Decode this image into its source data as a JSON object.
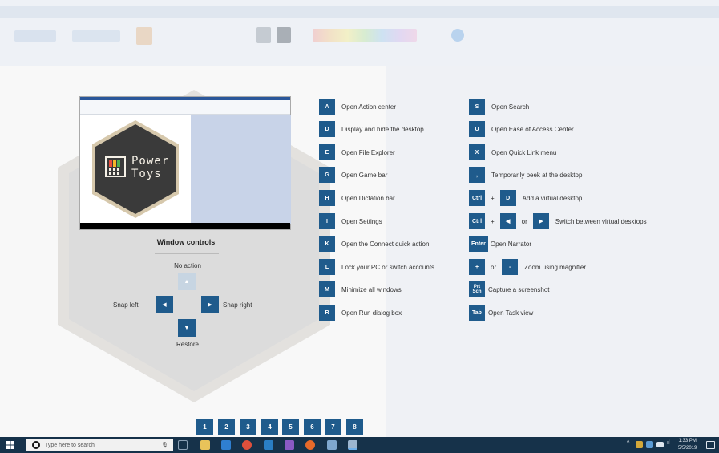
{
  "window_controls": {
    "title": "Window controls",
    "up_label": "No action",
    "left_label": "Snap left",
    "right_label": "Snap right",
    "down_label": "Restore"
  },
  "logo_text": [
    "Power",
    "Toys"
  ],
  "shortcuts_left": [
    {
      "key": "A",
      "label": "Open Action center"
    },
    {
      "key": "D",
      "label": "Display and hide the desktop"
    },
    {
      "key": "E",
      "label": "Open File Explorer"
    },
    {
      "key": "G",
      "label": "Open Game bar"
    },
    {
      "key": "H",
      "label": "Open Dictation bar"
    },
    {
      "key": "I",
      "label": "Open Settings"
    },
    {
      "key": "K",
      "label": "Open the Connect quick action"
    },
    {
      "key": "L",
      "label": "Lock your PC or switch accounts"
    },
    {
      "key": "M",
      "label": "Minimize all windows"
    },
    {
      "key": "R",
      "label": "Open Run dialog box"
    }
  ],
  "shortcuts_right": [
    {
      "key": "S",
      "label": "Open Search"
    },
    {
      "key": "U",
      "label": "Open Ease of Access Center"
    },
    {
      "key": "X",
      "label": "Open Quick Link menu"
    },
    {
      "key": ",",
      "label": "Temporarily peek at the desktop"
    },
    {
      "key": "Ctrl",
      "plus": "+",
      "key2": "D",
      "label": "Add a virtual desktop"
    },
    {
      "key": "Ctrl",
      "plus": "+",
      "key2": "◀",
      "or": "or",
      "key3": "▶",
      "label": "Switch between virtual desktops"
    },
    {
      "key": "Enter",
      "label": "Open Narrator"
    },
    {
      "key": "+",
      "or": "or",
      "key2": "-",
      "label": "Zoom using magnifier"
    },
    {
      "key": "Prt Scn",
      "label": "Capture a screenshot"
    },
    {
      "key": "Tab",
      "label": "Open Task view"
    }
  ],
  "taskbar": {
    "search_placeholder": "Type here to search",
    "number_badges": [
      "1",
      "2",
      "3",
      "4",
      "5",
      "6",
      "7",
      "8"
    ],
    "clock_time": "1:33 PM",
    "clock_date": "5/5/2019"
  },
  "colors": {
    "key_blue": "#1f5b8c",
    "taskbar": "#16324a"
  },
  "icons": {
    "start": "windows-logo-icon",
    "search": "cortana-circle-icon",
    "mic": "microphone-icon"
  }
}
